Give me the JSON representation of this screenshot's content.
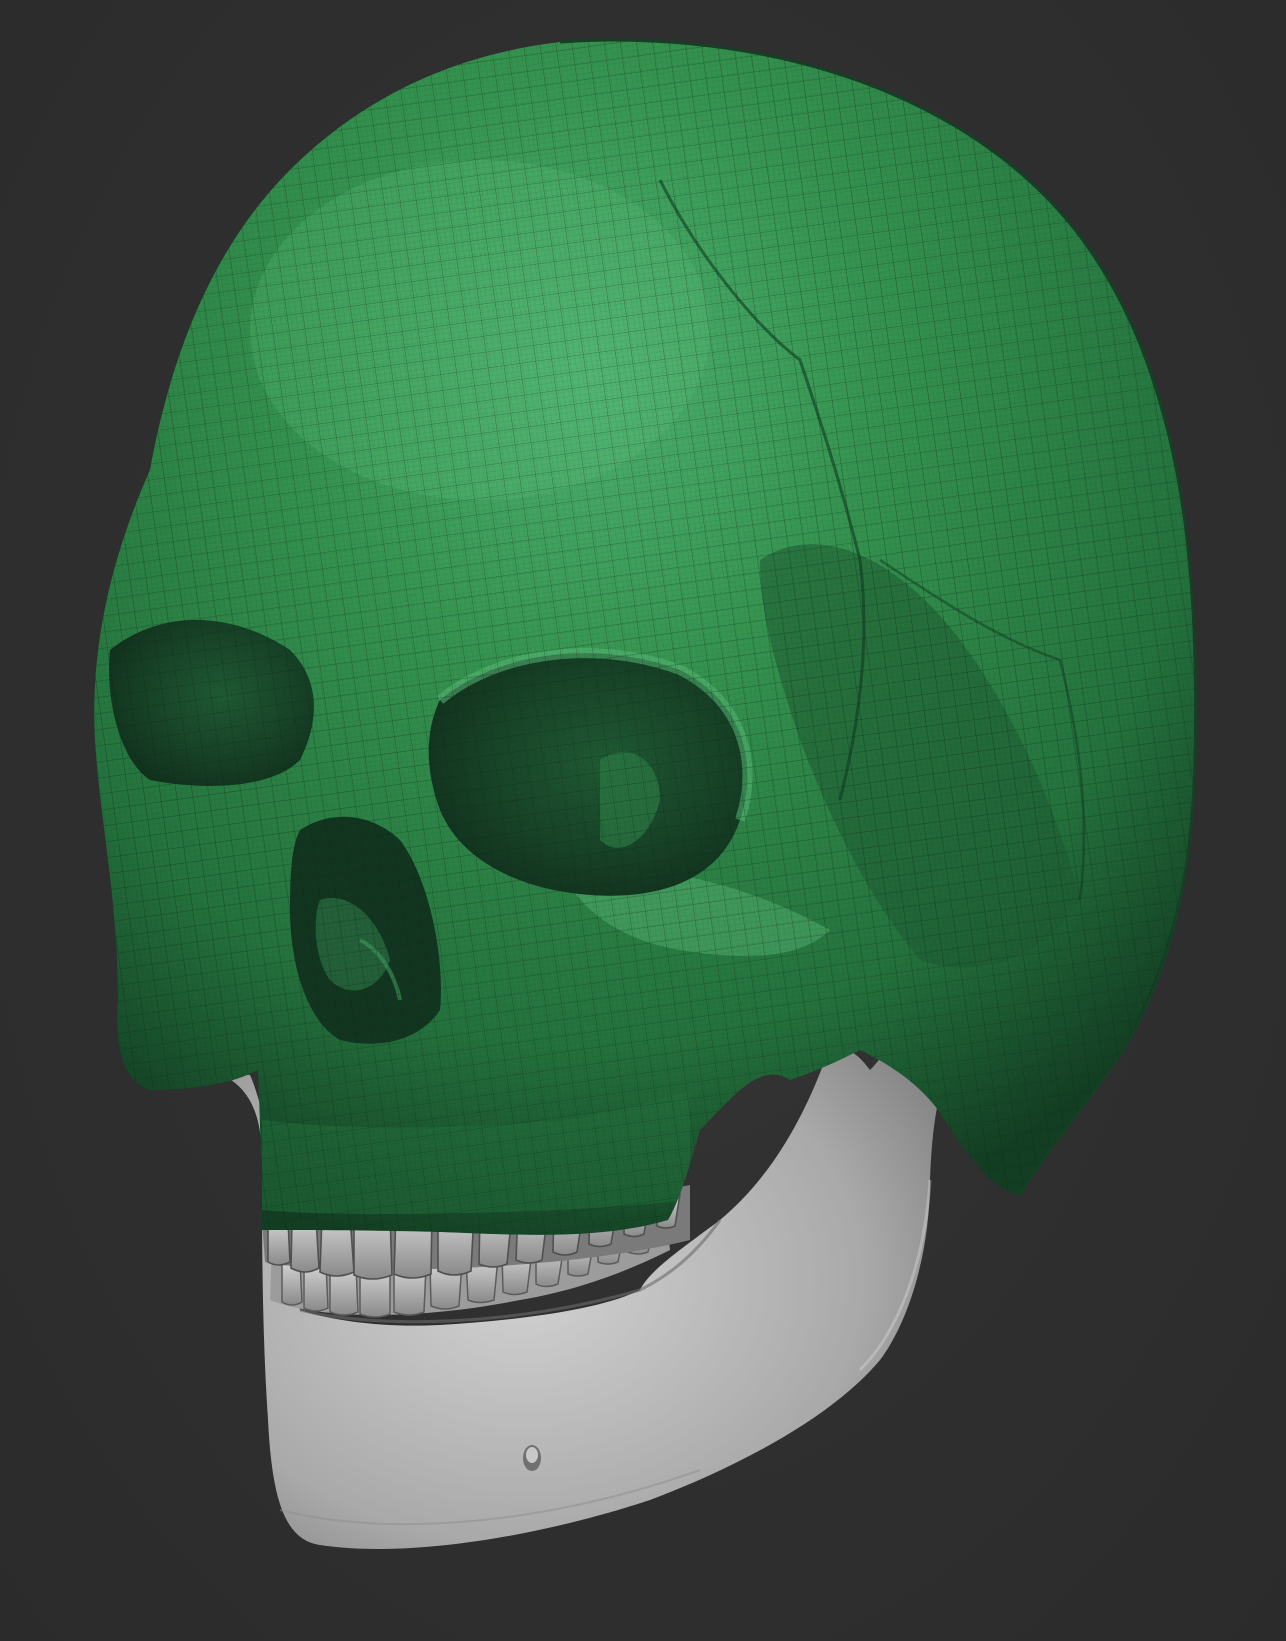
{
  "scene": {
    "subject": "skull-sculpt",
    "colors": {
      "background": "#2e2e2e",
      "cranium": "#2f8a4c",
      "cranium_highlight": "#49ad6a",
      "cranium_shadow": "#123a22",
      "wireframe": "#0c2a16",
      "mandible": "#b9b9b9",
      "mandible_shadow": "#6d6d6d",
      "teeth": "#c2c2c2"
    }
  }
}
